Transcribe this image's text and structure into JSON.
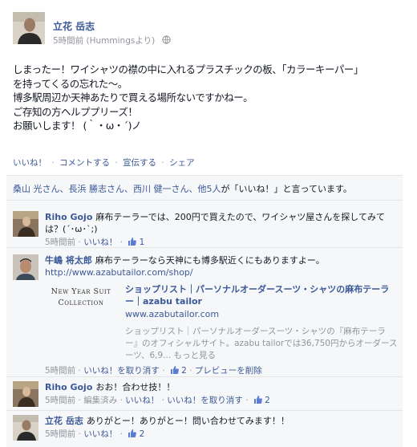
{
  "post": {
    "author": "立花 岳志",
    "time": "5時間前",
    "via": "(Hummingsより)",
    "lines": [
      "しまったー！ワイシャツの襟の中に入れるプラスチックの板、「カラーキーパー」",
      "を持ってくるの忘れた〜。",
      "博多駅周辺か天神あたりで買える場所ないですかねー。",
      "ご存知の方ヘルププリーズ！",
      "お願いします！ (｀・ω・´)ノ"
    ]
  },
  "actions": {
    "like": "いいね！",
    "comment": "コメントする",
    "share_promote": "宣伝する",
    "share": "シェア",
    "separator": "·"
  },
  "likes": {
    "names": "桑山 光さん、長浜 勝志さん、西川 健一さん、他5人",
    "suffix": "が「いいね！」と言っています。"
  },
  "comments": [
    {
      "author": "Riho Gojo",
      "text": "麻布テーラーでは、200円で買えたので、ワイシャツ屋さんを探してみては？(´･ω･`;)",
      "time": "5時間前",
      "like": "いいね！",
      "likes_count": "1"
    },
    {
      "author": "牛嶋 将太郎",
      "text": "麻布テーラーなら天神にも博多駅近くにもありますよー。",
      "link": "http://www.azabutailor.com/shop/",
      "share": {
        "thumb_line1": "New Year Suit",
        "thumb_line2": "Collection",
        "title": "ショップリスト｜パーソナルオーダースーツ・シャツの麻布テーラー｜azabu tailor",
        "domain": "www.azabutailor.com",
        "desc": "ショップリスト｜パーソナルオーダースーツ・シャツの『麻布テーラー』のオフィシャルサイト。azabu tailorでは36,750円からオーダースーツ、6,9... もっと見る"
      },
      "time": "5時間前",
      "unlike": "いいね！を取り消す",
      "likes_count": "2",
      "remove_preview": "プレビューを削除"
    },
    {
      "author": "Riho Gojo",
      "text": "おお！合わせ技！！",
      "time": "5時間前",
      "edited": "編集済み",
      "like": "いいね！",
      "unlike": "いいね！を取り消す",
      "likes_count": "2"
    },
    {
      "author": "立花 岳志",
      "text": "ありがとー！ありがとー！問い合わせてみます！！",
      "time": "5時間前",
      "like": "いいね！",
      "likes_count": "2"
    }
  ],
  "colors": {
    "link": "#3b5998",
    "meta": "#90949c",
    "ufi_bg": "#f6f7f9"
  }
}
